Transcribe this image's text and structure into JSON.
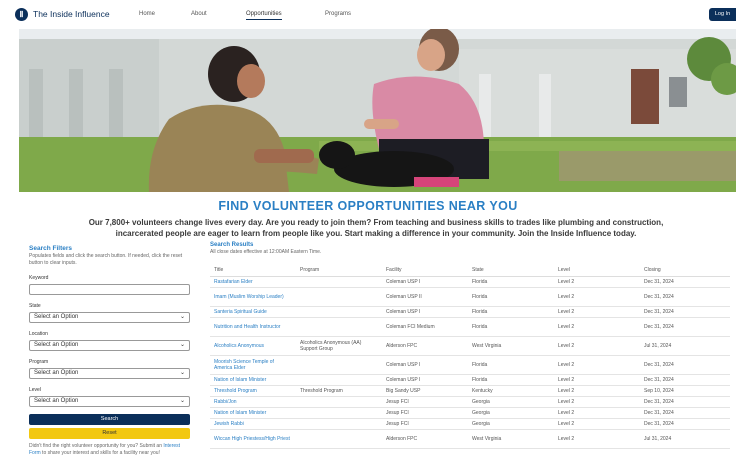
{
  "nav": {
    "logo_letter": "Ⅱ",
    "brand": "The Inside Influence",
    "links": [
      "Home",
      "About",
      "Opportunities",
      "Programs"
    ],
    "login": "Log In"
  },
  "page": {
    "title": "FIND VOLUNTEER OPPORTUNITIES NEAR YOU",
    "intro_line1": "Our 7,800+ volunteers change lives every day. Are you ready to join them? From teaching and business skills to trades like plumbing and construction,",
    "intro_line2": "incarcerated people are eager to learn from people like you. Start making a difference in your community. Join the Inside Influence today."
  },
  "filters": {
    "title": "Search Filters",
    "help": "Populates fields and click the search button. If needed, click the reset button to clear inputs.",
    "keyword_label": "Keyword",
    "keyword_value": "",
    "state_label": "State",
    "location_label": "Location",
    "program_label": "Program",
    "level_label": "Level",
    "select_placeholder": "Select an Option",
    "search_button": "Search",
    "reset_button": "Reset",
    "footer_pre": "Didn't find the right volunteer opportunity for you? Submit an ",
    "footer_link": "Interest Form",
    "footer_post": " to share your interest and skills for a facility near you!"
  },
  "results": {
    "title": "Search Results",
    "subtitle": "All close dates effective at 12:00AM Eastern Time.",
    "columns": [
      "Title",
      "Program",
      "Facility",
      "State",
      "Level",
      "Closing"
    ],
    "rows": [
      [
        "Rastafarian Elder",
        "",
        "Coleman USP I",
        "Florida",
        "Level 2",
        "Dec 31, 2024"
      ],
      [
        "Imam (Muslim Worship Leader)",
        "",
        "Coleman USP II",
        "Florida",
        "Level 2",
        "Dec 31, 2024"
      ],
      [
        "Santeria Spiritual Guide",
        "",
        "Coleman USP I",
        "Florida",
        "Level 2",
        "Dec 31, 2024"
      ],
      [
        "Nutrition and Health Instructor",
        "",
        "Coleman FCI Medium",
        "Florida",
        "Level 2",
        "Dec 31, 2024"
      ],
      [
        "Alcoholics Anonymous",
        "Alcoholics Anonymous (AA) Support Group",
        "Alderson FPC",
        "West Virginia",
        "Level 2",
        "Jul 31, 2024"
      ],
      [
        "Moorish Science Temple of America Elder",
        "",
        "Coleman USP I",
        "Florida",
        "Level 2",
        "Dec 31, 2024"
      ],
      [
        "Nation of Islam Minister",
        "",
        "Coleman USP I",
        "Florida",
        "Level 2",
        "Dec 31, 2024"
      ],
      [
        "Threshold Program",
        "Threshold Program",
        "Big Sandy USP",
        "Kentucky",
        "Level 2",
        "Sep 10, 2024"
      ],
      [
        "Rabbi/Jon",
        "",
        "Jesup FCI",
        "Georgia",
        "Level 2",
        "Dec 31, 2024"
      ],
      [
        "Nation of Islam Minister",
        "",
        "Jesup FCI",
        "Georgia",
        "Level 2",
        "Dec 31, 2024"
      ],
      [
        "Jewish Rabbi",
        "",
        "Jesup FCI",
        "Georgia",
        "Level 2",
        "Dec 31, 2024"
      ],
      [
        "Wiccan High Priestess/High Priest",
        "",
        "Alderson FPC",
        "West Virginia",
        "Level 2",
        "Jul 31, 2024"
      ]
    ]
  }
}
